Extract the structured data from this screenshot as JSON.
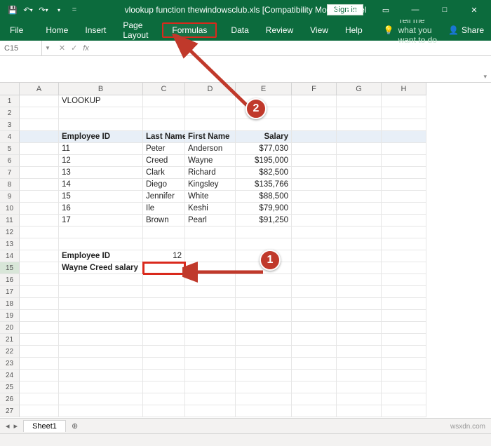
{
  "title": "vlookup function thewindowsclub.xls  [Compatibility Mode]  -  Excel",
  "signin": "Sign in",
  "ribbon": {
    "file": "File",
    "home": "Home",
    "insert": "Insert",
    "page_layout": "Page Layout",
    "formulas": "Formulas",
    "data": "Data",
    "review": "Review",
    "view": "View",
    "help": "Help",
    "tell_me": "Tell me what you want to do",
    "share": "Share"
  },
  "namebox": "C15",
  "columns": [
    "A",
    "B",
    "C",
    "D",
    "E",
    "F",
    "G",
    "H"
  ],
  "rows_visible": 27,
  "content": {
    "b1": "VLOOKUP",
    "b4": "Employee ID",
    "c4": "Last Name",
    "d4": "First Name",
    "e4": "Salary",
    "b5": "11",
    "c5": "Peter",
    "d5": "Anderson",
    "e5": "$77,030",
    "b6": "12",
    "c6": "Creed",
    "d6": "Wayne",
    "e6": "$195,000",
    "b7": "13",
    "c7": "Clark",
    "d7": "Richard",
    "e7": "$82,500",
    "b8": "14",
    "c8": "Diego",
    "d8": "Kingsley",
    "e8": "$135,766",
    "b9": "15",
    "c9": "Jennifer",
    "d9": "White",
    "e9": "$88,500",
    "b10": "16",
    "c10": "Ile",
    "d10": "Keshi",
    "e10": "$79,900",
    "b11": "17",
    "c11": "Brown",
    "d11": "Pearl",
    "e11": "$91,250",
    "b14": "Employee ID",
    "c14": "12",
    "b15": "Wayne Creed salary"
  },
  "sheet_tab": "Sheet1",
  "annotations": {
    "badge1": "1",
    "badge2": "2"
  },
  "watermark": "wsxdn.com"
}
